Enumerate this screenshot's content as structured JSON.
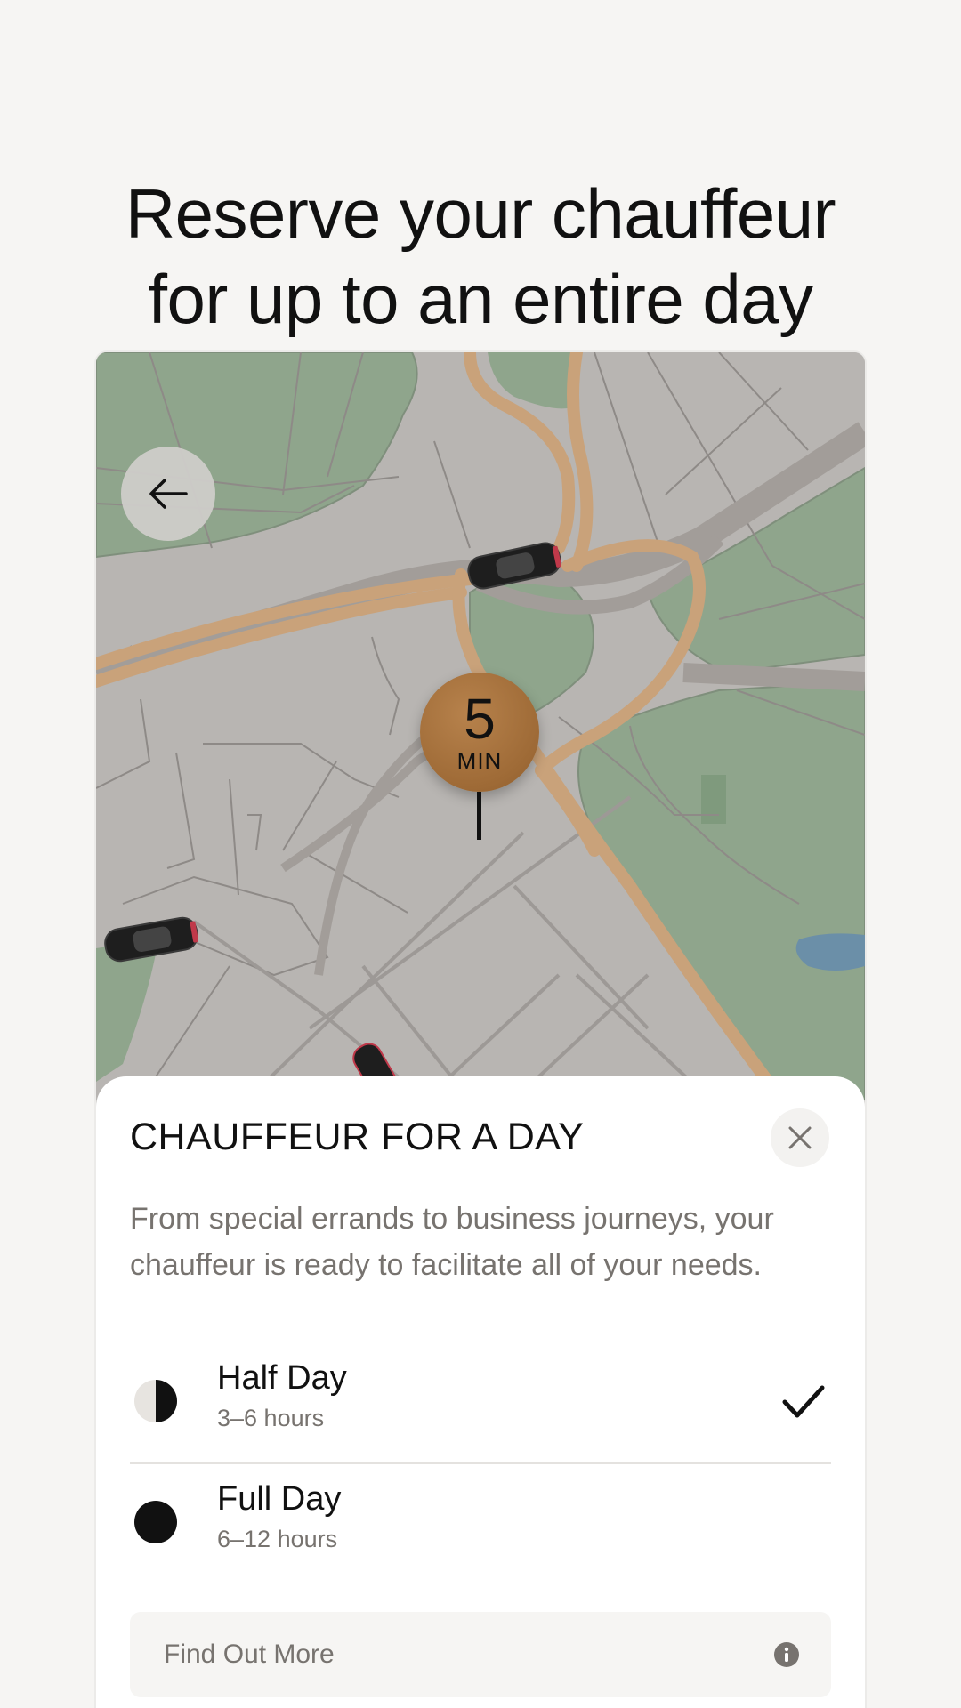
{
  "headline": {
    "line1": "Reserve your chauffeur",
    "line2": "for up to an entire day"
  },
  "map": {
    "back_icon": "arrow-left-icon",
    "eta": {
      "value": "5",
      "unit": "MIN",
      "color": "#a36e3a"
    },
    "colors": {
      "land": "#b8b5b2",
      "park": "#8fa58c",
      "major_road": "#c9a27a",
      "highway": "#a29d99",
      "water": "#6b8fa8"
    }
  },
  "sheet": {
    "title": "CHAUFFEUR FOR A DAY",
    "close_icon": "close-icon",
    "description": "From special errands to business journeys, your chauffeur is ready to facilitate all of your needs.",
    "options": [
      {
        "label": "Half Day",
        "duration": "3–6 hours",
        "icon": "half-circle-icon",
        "selected": true
      },
      {
        "label": "Full Day",
        "duration": "6–12 hours",
        "icon": "full-circle-icon",
        "selected": false
      }
    ],
    "more": {
      "label": "Find Out More",
      "icon": "info-icon"
    }
  }
}
